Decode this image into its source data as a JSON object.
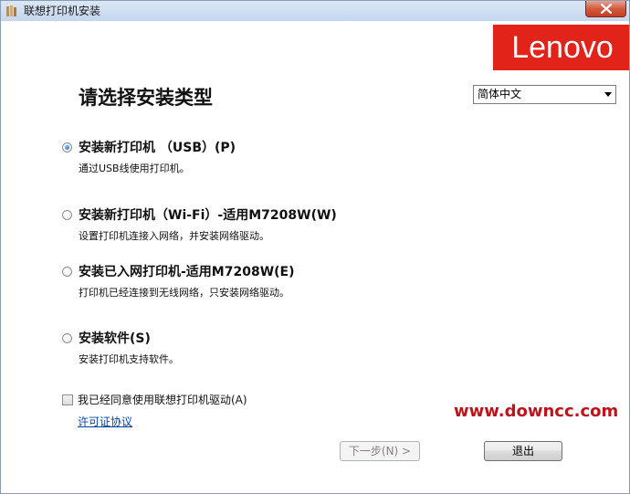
{
  "window": {
    "title": "联想打印机安装"
  },
  "brand": {
    "logo_text": "Lenovo",
    "color": "#e2231a"
  },
  "page": {
    "title": "请选择安装类型"
  },
  "language_select": {
    "selected": "简体中文"
  },
  "options": [
    {
      "label": "安装新打印机 （USB）(P)",
      "description": "通过USB线使用打印机。",
      "selected": true
    },
    {
      "label": "安装新打印机（Wi-Fi）-适用M7208W(W)",
      "description": "设置打印机连接入网络，并安装网络驱动。",
      "selected": false
    },
    {
      "label": "安装已入网打印机-适用M7208W(E)",
      "description": "打印机已经连接到无线网络，只安装网络驱动。",
      "selected": false
    },
    {
      "label": "安装软件(S)",
      "description": "安装打印机支持软件。",
      "selected": false
    }
  ],
  "agreement": {
    "checkbox_label": "我已经同意使用联想打印机驱动(A)",
    "checked": false,
    "license_link": "许可证协议"
  },
  "watermark": {
    "text": "www.downcc.com",
    "color": "#c0121b"
  },
  "buttons": {
    "next_label": "下一步(N) >",
    "next_enabled": false,
    "exit_label": "退出"
  }
}
